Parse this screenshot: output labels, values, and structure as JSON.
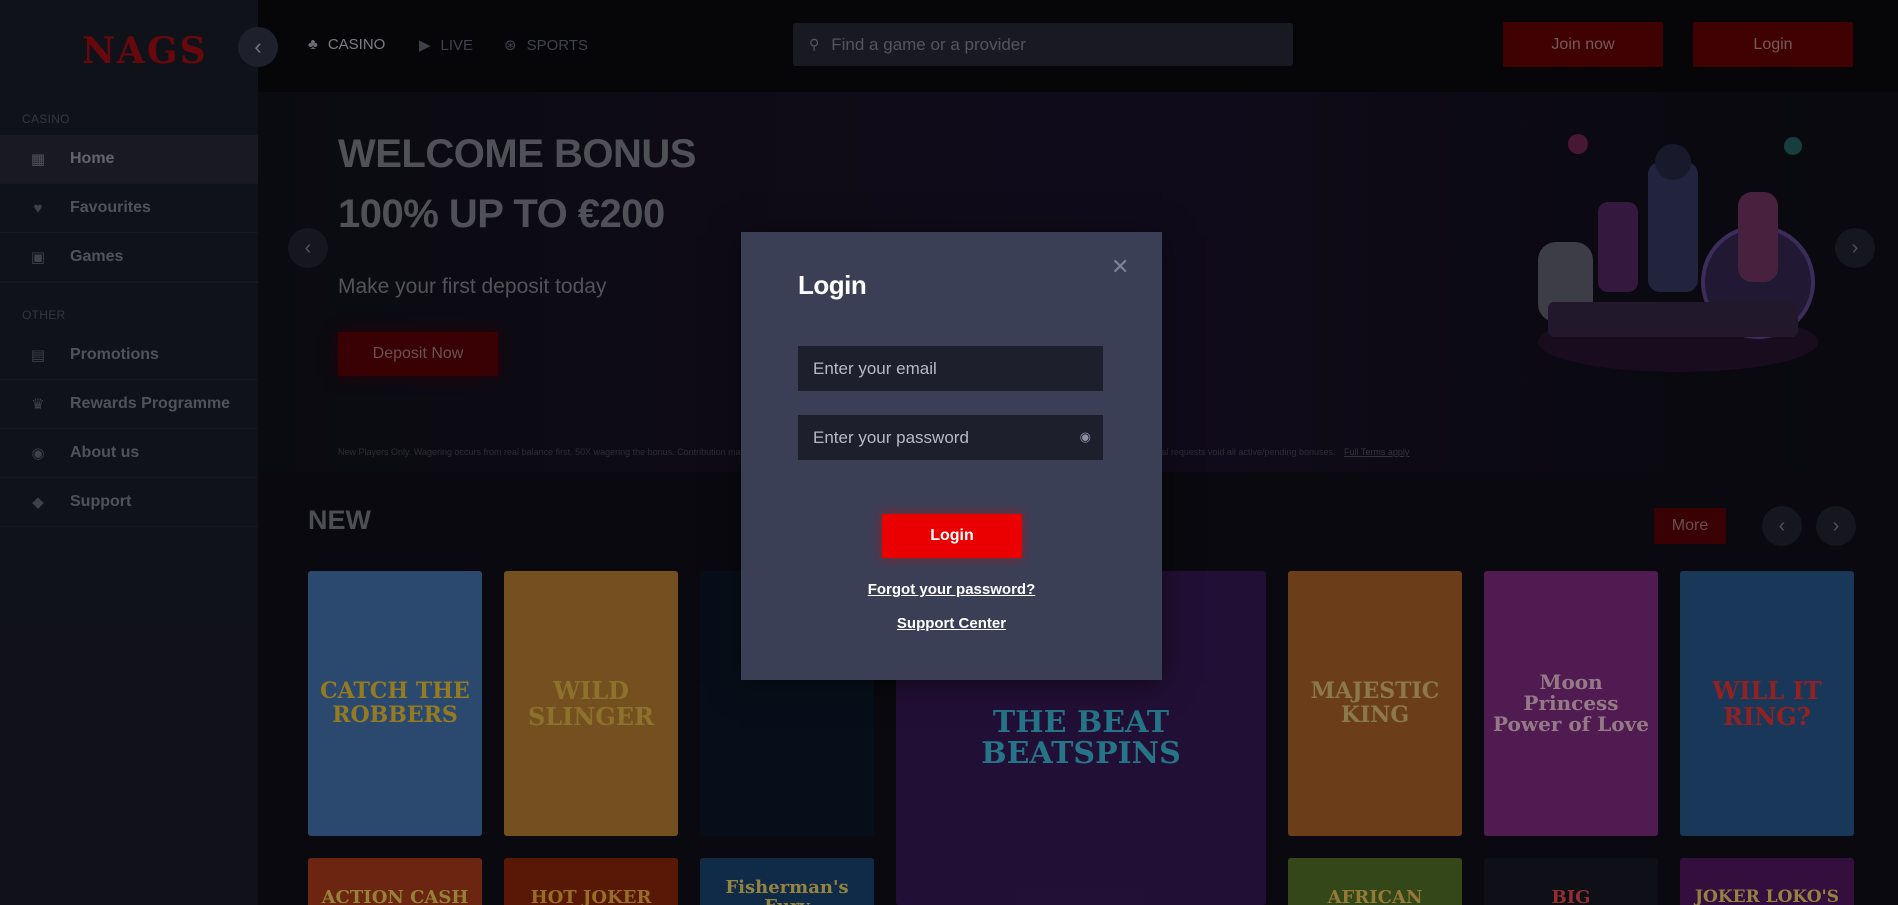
{
  "brand": {
    "logo_text": "NAGS",
    "accent": "#ea0000",
    "dark_accent": "#6e0206"
  },
  "sidebar": {
    "collapse_icon": "chevron-left-icon",
    "sections": [
      {
        "label": "CASINO",
        "items": [
          {
            "label": "Home",
            "icon": "grid-icon",
            "active": true
          },
          {
            "label": "Favourites",
            "icon": "heart-icon"
          },
          {
            "label": "Games",
            "icon": "slot-machine-icon"
          }
        ]
      },
      {
        "label": "OTHER",
        "items": [
          {
            "label": "Promotions",
            "icon": "gift-icon"
          },
          {
            "label": "Rewards Programme",
            "icon": "trophy-icon"
          },
          {
            "label": "About us",
            "icon": "info-icon"
          },
          {
            "label": "Support",
            "icon": "chat-icon"
          }
        ]
      }
    ]
  },
  "topbar": {
    "tabs": [
      {
        "label": "CASINO",
        "icon": "cards-icon",
        "active": true
      },
      {
        "label": "LIVE",
        "icon": "live-camera-icon"
      },
      {
        "label": "SPORTS",
        "icon": "ball-icon"
      }
    ],
    "search_placeholder": "Find a game or a provider",
    "join_label": "Join now",
    "login_label": "Login"
  },
  "hero": {
    "title_line1": "WELCOME BONUS",
    "title_line2": "100% UP TO €200",
    "subtitle": "Make your first deposit today",
    "cta": "Deposit Now",
    "terms": "New Players Only. Wagering occurs from real balance first. 50X wagering the bonus. Contribution may vary per game. Bonus valid 30 Days from receipt. Max conversion: 3 times the bonus amount. Withdrawal requests void all active/pending bonuses.",
    "terms_link": "Full Terms apply"
  },
  "new_section": {
    "title": "NEW",
    "more_label": "More",
    "games": [
      {
        "title": "CATCH THE ROBBERS",
        "bg": "#4a7fc0"
      },
      {
        "title": "WILD SLINGER",
        "bg": "#c88a3a"
      },
      {
        "title": "",
        "bg": "#0c1a2c"
      },
      {
        "title": "THE BEAT BEATSPINS",
        "bg": "#3b1b5e"
      },
      {
        "title": "MAJESTIC KING",
        "bg": "#b86a2a"
      },
      {
        "title": "Moon Princess Power of Love",
        "bg": "#8a2f8a"
      },
      {
        "title": "WILL IT RING?",
        "bg": "#2a5f9a"
      }
    ],
    "row2": [
      {
        "title": "ACTION CASH",
        "bg": "#b8401c"
      },
      {
        "title": "HOT JOKER",
        "bg": "#9a2a0a"
      },
      {
        "title": "Fisherman's Fury",
        "bg": "#1a4a7a"
      },
      {
        "title": "AFRICAN",
        "bg": "#5a7a2a"
      },
      {
        "title": "BIG",
        "bg": "#1a1a2a"
      },
      {
        "title": "JOKER LOKO'S",
        "bg": "#5a1a6a"
      }
    ]
  },
  "login_modal": {
    "title": "Login",
    "email_placeholder": "Enter your email",
    "password_placeholder": "Enter your password",
    "submit_label": "Login",
    "forgot_label": "Forgot your password?",
    "support_label": "Support Center"
  }
}
